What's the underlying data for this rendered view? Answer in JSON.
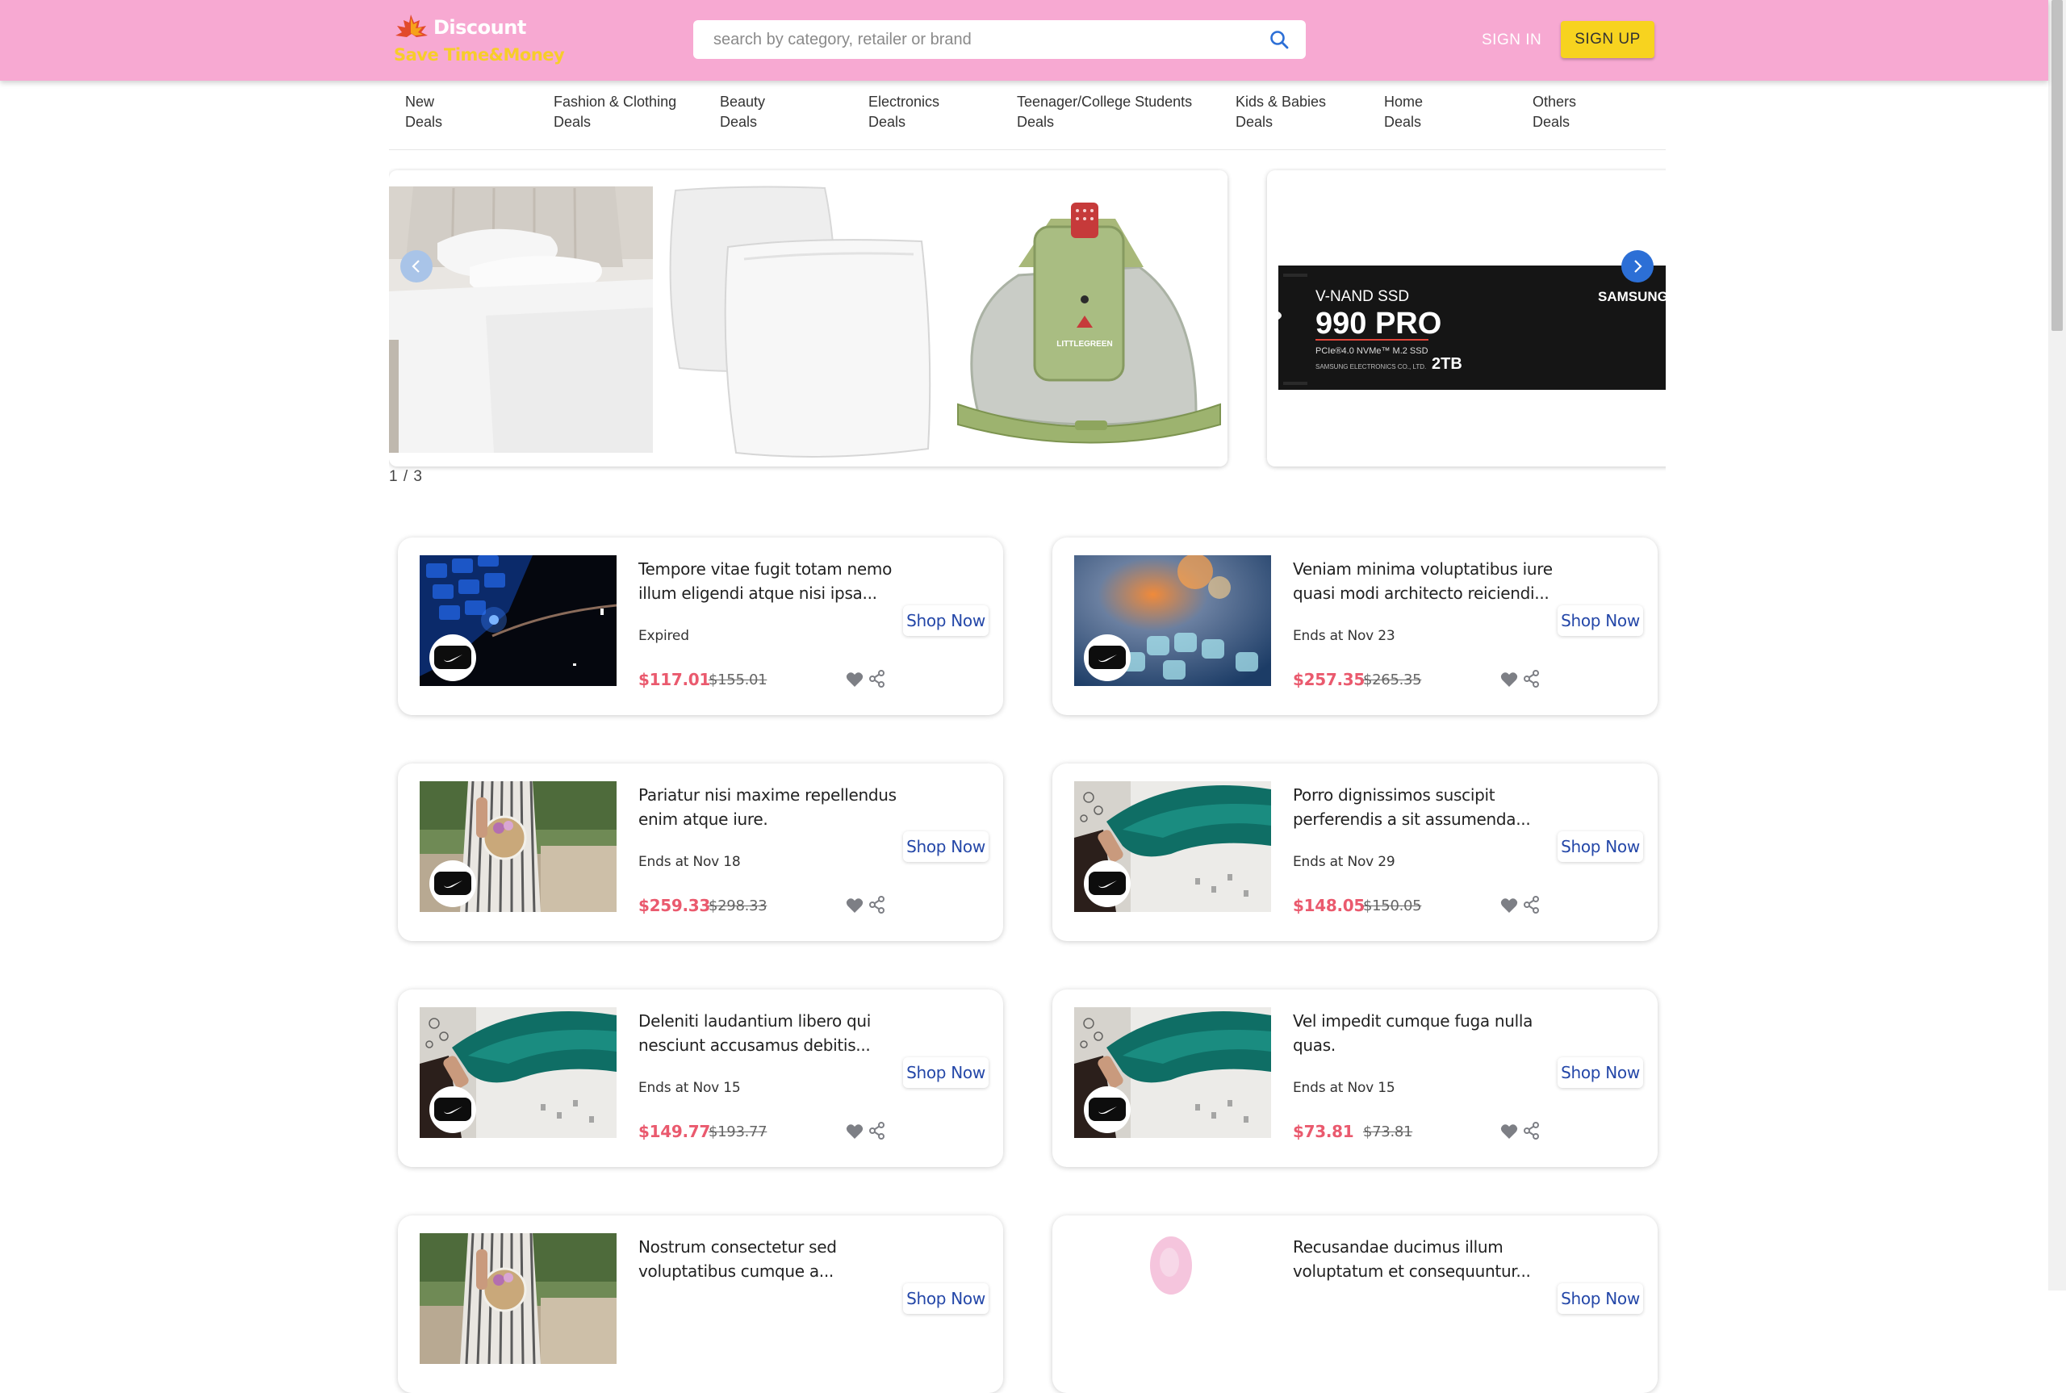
{
  "header": {
    "brand": "Discount",
    "tagline": "Save Time&Money",
    "search_placeholder": "search by category, retailer or brand",
    "search_icon": "search-icon",
    "sign_in": "SIGN IN",
    "sign_up": "SIGN UP",
    "colors": {
      "header_bg": "#f7a9d2",
      "tagline": "#f7cd2a",
      "signup_bg": "#f7d31f"
    }
  },
  "nav": {
    "items": [
      {
        "line1": "New",
        "line2": "Deals"
      },
      {
        "line1": "Fashion & Clothing",
        "line2": "Deals"
      },
      {
        "line1": "Beauty",
        "line2": "Deals"
      },
      {
        "line1": "Electronics",
        "line2": "Deals"
      },
      {
        "line1": "Teenager/College Students",
        "line2": "Deals"
      },
      {
        "line1": "Kids & Babies",
        "line2": "Deals"
      },
      {
        "line1": "Home",
        "line2": "Deals"
      },
      {
        "line1": "Others",
        "line2": "Deals"
      }
    ]
  },
  "carousel": {
    "counter": "1 / 3",
    "ssd": {
      "line1": "V-NAND SSD",
      "model": "990 PRO",
      "spec": "PCIe®4.0 NVMe™ M.2 SSD",
      "maker_line": "SAMSUNG ELECTRONICS CO., LTD.",
      "capacity": "2TB",
      "brand": "SAMSUNG"
    },
    "cleaner_label": "LITTLEGREEN",
    "prev_icon": "chevron-left-icon",
    "next_icon": "chevron-right-icon"
  },
  "deals": [
    {
      "title": "Tempore vitae fugit totam nemo illum eligendi atque nisi ipsa...",
      "status": "Expired",
      "price": "$117.01",
      "old_price": "$155.01",
      "cta": "Shop Now"
    },
    {
      "title": "Veniam minima voluptatibus iure quasi modi architecto reiciendi...",
      "status": "Ends at Nov 23",
      "price": "$257.35",
      "old_price": "$265.35",
      "cta": "Shop Now"
    },
    {
      "title": "Pariatur nisi maxime repellendus enim atque iure.",
      "status": "Ends at Nov 18",
      "price": "$259.33",
      "old_price": "$298.33",
      "cta": "Shop Now"
    },
    {
      "title": "Porro dignissimos suscipit perferendis a sit assumenda...",
      "status": "Ends at Nov 29",
      "price": "$148.05",
      "old_price": "$150.05",
      "cta": "Shop Now"
    },
    {
      "title": "Deleniti laudantium libero qui nesciunt accusamus debitis...",
      "status": "Ends at Nov 15",
      "price": "$149.77",
      "old_price": "$193.77",
      "cta": "Shop Now"
    },
    {
      "title": "Vel impedit cumque fuga nulla quas.",
      "status": "Ends at Nov 15",
      "price": "$73.81",
      "old_price": "$73.81",
      "cta": "Shop Now"
    },
    {
      "title": "Nostrum consectetur sed voluptatibus cumque a...",
      "status": "",
      "price": "",
      "old_price": "",
      "cta": "Shop Now"
    },
    {
      "title": "Recusandae ducimus illum voluptatum et consequuntur...",
      "status": "",
      "price": "",
      "old_price": "",
      "cta": "Shop Now"
    }
  ]
}
